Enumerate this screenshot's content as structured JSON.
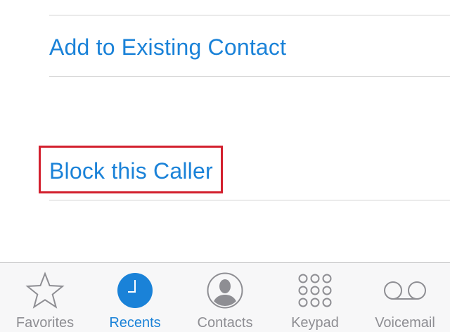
{
  "actions": {
    "add_to_existing": "Add to Existing Contact",
    "block_caller": "Block this Caller"
  },
  "tabbar": {
    "favorites": "Favorites",
    "recents": "Recents",
    "contacts": "Contacts",
    "keypad": "Keypad",
    "voicemail": "Voicemail",
    "active": "recents"
  },
  "colors": {
    "accent": "#1a82d8",
    "highlight": "#d3202e",
    "inactive": "#8e8e93"
  }
}
